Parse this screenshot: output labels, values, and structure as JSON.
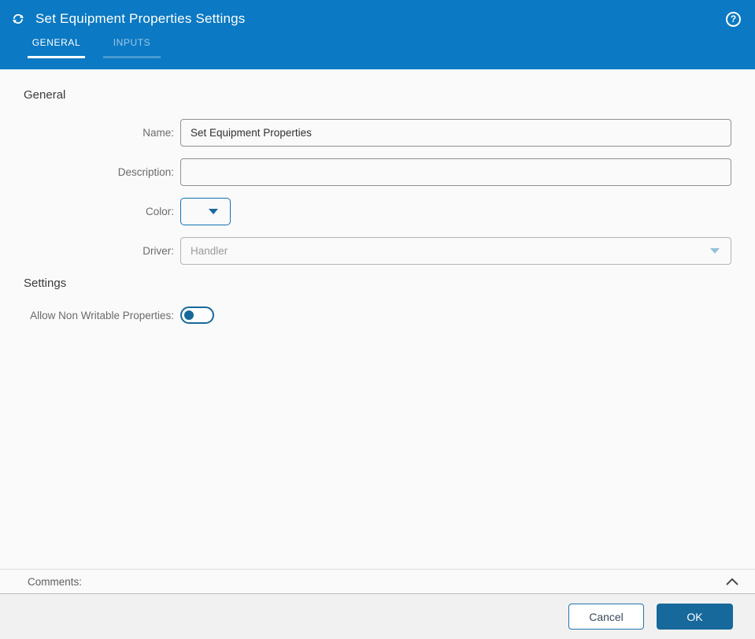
{
  "header": {
    "title": "Set Equipment Properties Settings",
    "title_icon": "sync-arrows-icon",
    "help_glyph": "?",
    "tabs": [
      {
        "label": "GENERAL",
        "active": true
      },
      {
        "label": "INPUTS",
        "active": false
      }
    ]
  },
  "general_section": {
    "heading": "General",
    "fields": {
      "name": {
        "label": "Name:",
        "value": "Set Equipment Properties"
      },
      "description": {
        "label": "Description:",
        "value": ""
      },
      "color": {
        "label": "Color:",
        "value": ""
      },
      "driver": {
        "label": "Driver:",
        "value": "Handler",
        "disabled": true
      }
    }
  },
  "settings_section": {
    "heading": "Settings",
    "allow_non_writable": {
      "label": "Allow Non Writable Properties:",
      "value": false
    }
  },
  "comments": {
    "label": "Comments:"
  },
  "footer": {
    "cancel_label": "Cancel",
    "ok_label": "OK"
  },
  "colors": {
    "header_bg": "#0b79c3",
    "accent_dark": "#17699b",
    "body_bg": "#fafafa",
    "footer_bg": "#f1f1f1",
    "inactive_tab_text": "#9ec8e6",
    "input_border": "#919191",
    "disabled_text": "#9a9a9a"
  }
}
